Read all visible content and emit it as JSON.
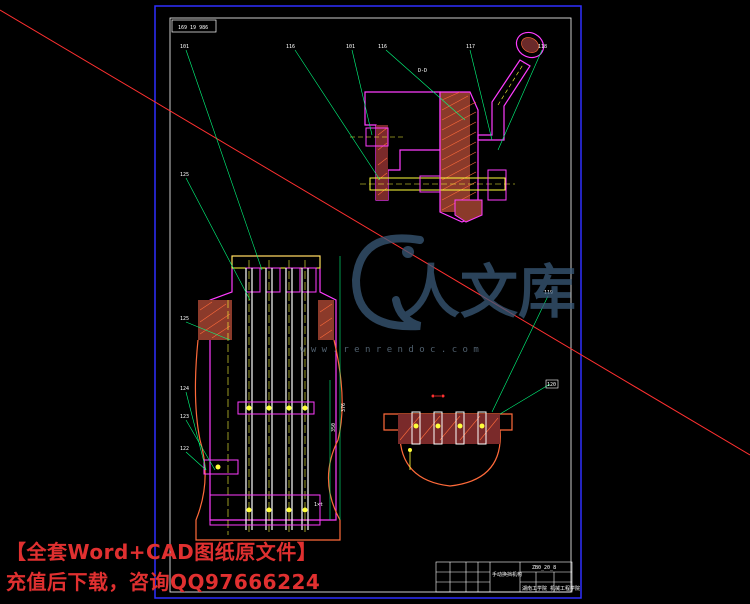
{
  "drawing": {
    "title_block_label": "169 19 986",
    "section_label": "D-D",
    "detail_label": "C-C",
    "title_block": {
      "name": "手动换挡机构",
      "number": "ZB0_20_8",
      "school": "湖南工学院",
      "sheet": "机械工程学院"
    },
    "part_numbers": {
      "p1": "101",
      "p2": "116",
      "p3": "101",
      "p4": "116",
      "p5": "117",
      "p6": "118",
      "p7": "125",
      "p8": "125",
      "p9": "124",
      "p10": "123",
      "p11": "122",
      "p12": "119",
      "p13": "120"
    },
    "dimensions": {
      "d1": "376",
      "d2": "350",
      "d3": "1×t"
    }
  },
  "watermark": {
    "brand": "人文库",
    "domain": "w w w . r e n r e n d o c . c o m"
  },
  "promo": {
    "line1": "【全套Word+CAD图纸原文件】",
    "line2": "充值后下载，咨询QQ97666224"
  },
  "colors": {
    "background": "#000000",
    "frame": "#2f2fff",
    "outline": "#ff3cff",
    "leaders": "#00ff7f",
    "hatch": "#ff6a3a",
    "yellow": "#ffff3a",
    "cyan": "#3affff",
    "promo_red": "#e03030"
  }
}
